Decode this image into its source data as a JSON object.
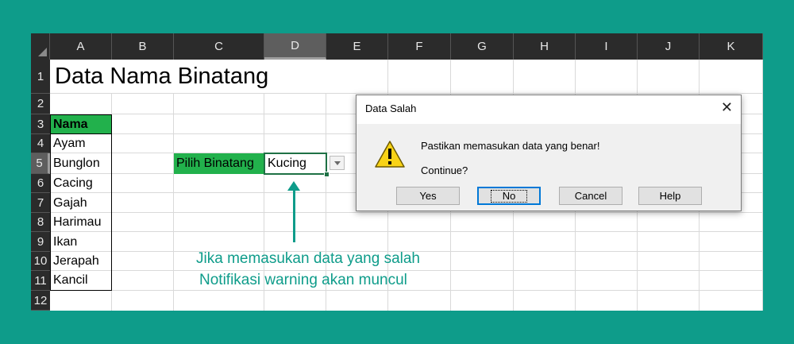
{
  "spreadsheet": {
    "columns": [
      "A",
      "B",
      "C",
      "D",
      "E",
      "F",
      "G",
      "H",
      "I",
      "J",
      "K"
    ],
    "rows": [
      "1",
      "2",
      "3",
      "4",
      "5",
      "6",
      "7",
      "8",
      "9",
      "10",
      "11",
      "12"
    ],
    "title": "Data Nama Binatang",
    "header": "Nama",
    "animals": [
      "Ayam",
      "Bunglon",
      "Cacing",
      "Gajah",
      "Harimau",
      "Ikan",
      "Jerapah",
      "Kancil"
    ],
    "picker_label": "Pilih Binatang",
    "picker_value": "Kucing",
    "selected_column": "D",
    "selected_row": "5"
  },
  "annotation": {
    "line1": "Jika memasukan data yang salah",
    "line2": "Notifikasi warning akan muncul"
  },
  "dialog": {
    "title": "Data Salah",
    "message": "Pastikan memasukan data yang benar!",
    "question": "Continue?",
    "buttons": {
      "yes": "Yes",
      "no": "No",
      "cancel": "Cancel",
      "help": "Help"
    }
  },
  "colors": {
    "frame": "#0e9c8a",
    "header_green": "#22b14c",
    "selection": "#1e7145",
    "annotation": "#0e9c8a"
  },
  "icons": {
    "dialog_icon": "warning-icon",
    "close": "close-icon",
    "dropdown": "chevron-down-icon"
  }
}
